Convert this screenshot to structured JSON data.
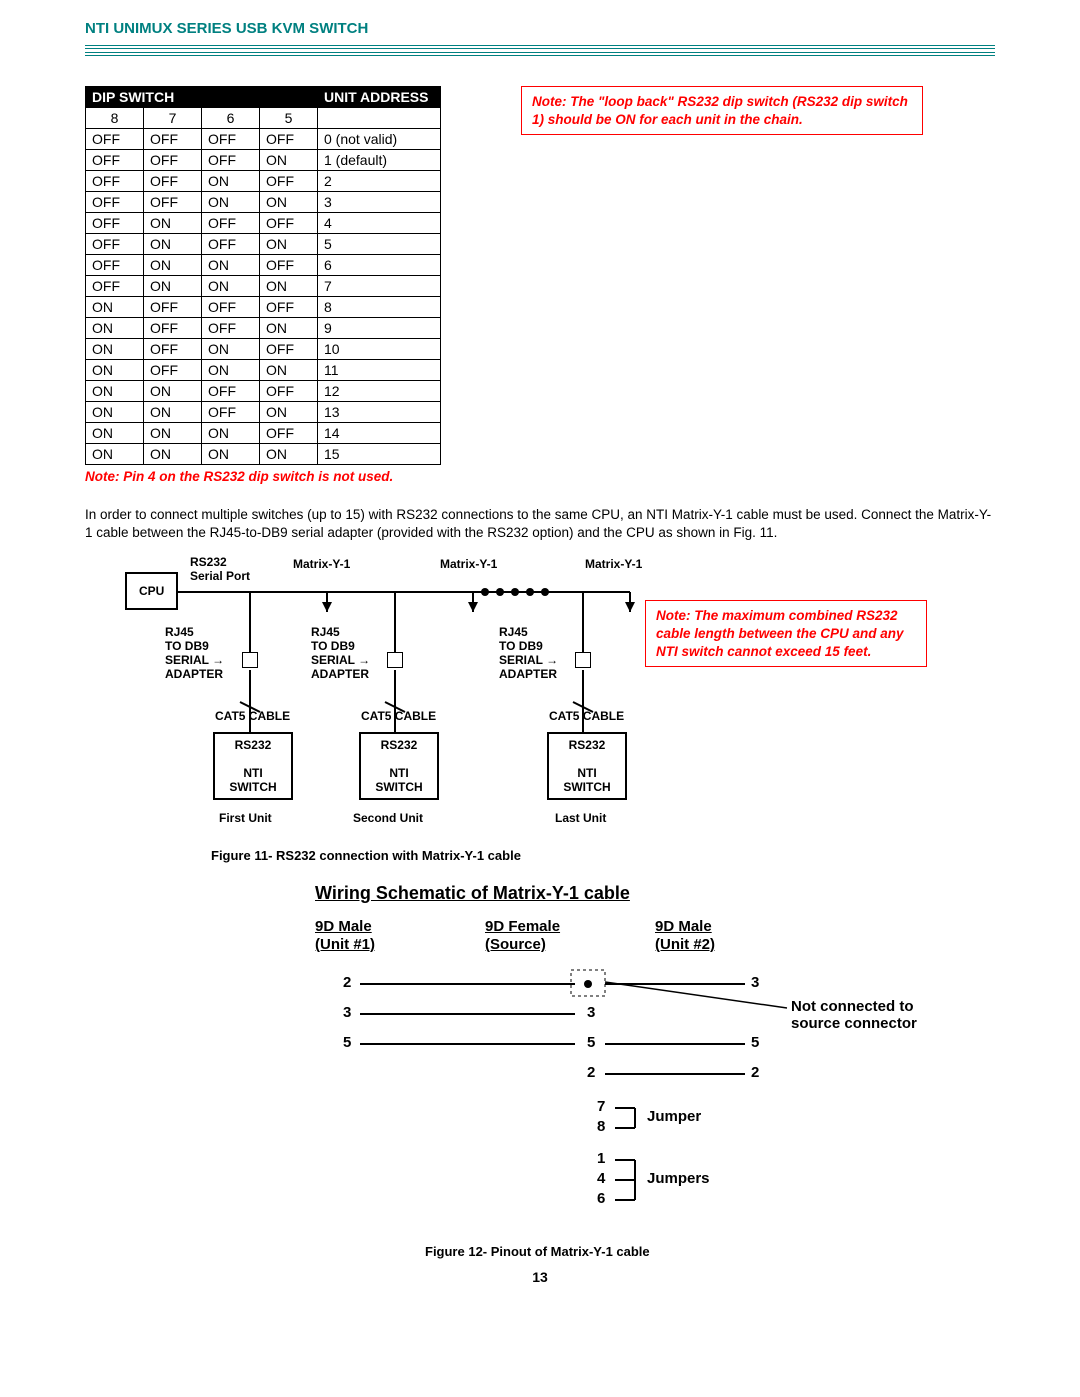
{
  "header": {
    "title": "NTI UNIMUX SERIES USB KVM SWITCH"
  },
  "dip_table": {
    "head_left": "DIP SWITCH",
    "head_right": "UNIT ADDRESS",
    "cols": [
      "8",
      "7",
      "6",
      "5"
    ],
    "rows": [
      {
        "c": [
          "OFF",
          "OFF",
          "OFF",
          "OFF"
        ],
        "addr": "0 (not valid)"
      },
      {
        "c": [
          "OFF",
          "OFF",
          "OFF",
          "ON"
        ],
        "addr": "1    (default)"
      },
      {
        "c": [
          "OFF",
          "OFF",
          "ON",
          "OFF"
        ],
        "addr": "2"
      },
      {
        "c": [
          "OFF",
          "OFF",
          "ON",
          "ON"
        ],
        "addr": "3"
      },
      {
        "c": [
          "OFF",
          "ON",
          "OFF",
          "OFF"
        ],
        "addr": "4"
      },
      {
        "c": [
          "OFF",
          "ON",
          "OFF",
          "ON"
        ],
        "addr": "5"
      },
      {
        "c": [
          "OFF",
          "ON",
          "ON",
          "OFF"
        ],
        "addr": "6"
      },
      {
        "c": [
          "OFF",
          "ON",
          "ON",
          "ON"
        ],
        "addr": "7"
      },
      {
        "c": [
          "ON",
          "OFF",
          "OFF",
          "OFF"
        ],
        "addr": "8"
      },
      {
        "c": [
          "ON",
          "OFF",
          "OFF",
          "ON"
        ],
        "addr": "9"
      },
      {
        "c": [
          "ON",
          "OFF",
          "ON",
          "OFF"
        ],
        "addr": "10"
      },
      {
        "c": [
          "ON",
          "OFF",
          "ON",
          "ON"
        ],
        "addr": "11"
      },
      {
        "c": [
          "ON",
          "ON",
          "OFF",
          "OFF"
        ],
        "addr": "12"
      },
      {
        "c": [
          "ON",
          "ON",
          "OFF",
          "ON"
        ],
        "addr": "13"
      },
      {
        "c": [
          "ON",
          "ON",
          "ON",
          "OFF"
        ],
        "addr": "14"
      },
      {
        "c": [
          "ON",
          "ON",
          "ON",
          "ON"
        ],
        "addr": "15"
      }
    ],
    "footnote": "Note:  Pin 4 on the RS232 dip switch is not used."
  },
  "note_loopback": "Note: The \"loop back\" RS232 dip switch (RS232 dip switch 1) should be ON for each unit in the chain.",
  "paragraph": "In order to connect multiple switches (up to 15) with RS232 connections to the same CPU, an NTI Matrix-Y-1 cable must be used. Connect the Matrix-Y-1 cable between the RJ45-to-DB9 serial adapter (provided with the RS232 option) and the CPU as shown in Fig. 11.",
  "diagram": {
    "cpu": "CPU",
    "rs232_serial_port": "RS232\nSerial Port",
    "matrix_y1": "Matrix-Y-1",
    "rj45_db9": "RJ45\nTO DB9\nSERIAL\nADAPTER",
    "cat5": "CAT5 CABLE",
    "rs232": "RS232",
    "nti_switch": "NTI\nSWITCH",
    "arrow": "→",
    "first_unit": "First Unit",
    "second_unit": "Second Unit",
    "last_unit": "Last Unit",
    "note_length": "Note: The maximum combined RS232 cable length between the CPU and any NTI switch cannot exceed 15 feet."
  },
  "fig11": "Figure 11- RS232 connection with Matrix-Y-1 cable",
  "schematic": {
    "title": "Wiring Schematic of Matrix-Y-1 cable",
    "h1": "9D Male\n(Unit #1)",
    "h2": "9D Female\n(Source)",
    "h3": "9D Male\n(Unit #2)",
    "pins_left": [
      "2",
      "3",
      "5"
    ],
    "pins_mid": [
      "3",
      "5",
      "2",
      "7",
      "8",
      "1",
      "4",
      "6"
    ],
    "pins_right": [
      "3",
      "5",
      "2"
    ],
    "jumper": "Jumper",
    "jumpers": "Jumpers",
    "not_connected": "Not connected to\nsource connector"
  },
  "fig12": "Figure 12- Pinout of Matrix-Y-1 cable",
  "page_number": "13"
}
